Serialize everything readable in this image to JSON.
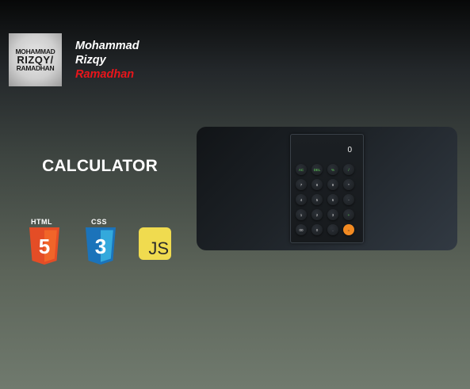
{
  "profile": {
    "logo_line1": "MOHAMMAD",
    "logo_line2": "RIZQY/",
    "logo_line3": "RAMADHAN",
    "name_first": "Mohammad",
    "name_middle": "Rizqy",
    "name_last": "Ramadhan"
  },
  "project": {
    "title": "CALCULATOR"
  },
  "tech_stack": {
    "html_label": "HTML",
    "html_number": "5",
    "css_label": "CSS",
    "css_number": "3",
    "js_label": "JS"
  },
  "calculator_preview": {
    "display_value": "0",
    "keys": [
      {
        "label": "AC",
        "style": "green"
      },
      {
        "label": "DEL",
        "style": "green"
      },
      {
        "label": "%",
        "style": "green"
      },
      {
        "label": "/",
        "style": "green"
      },
      {
        "label": "7",
        "style": "normal"
      },
      {
        "label": "8",
        "style": "normal"
      },
      {
        "label": "9",
        "style": "normal"
      },
      {
        "label": "*",
        "style": "normal"
      },
      {
        "label": "4",
        "style": "normal"
      },
      {
        "label": "5",
        "style": "normal"
      },
      {
        "label": "6",
        "style": "normal"
      },
      {
        "label": "-",
        "style": "normal"
      },
      {
        "label": "1",
        "style": "normal"
      },
      {
        "label": "2",
        "style": "normal"
      },
      {
        "label": "3",
        "style": "normal"
      },
      {
        "label": "+",
        "style": "green"
      },
      {
        "label": "00",
        "style": "normal"
      },
      {
        "label": "0",
        "style": "normal"
      },
      {
        "label": ".",
        "style": "normal"
      },
      {
        "label": "=",
        "style": "orange"
      }
    ]
  },
  "colors": {
    "accent_red": "#e8151b",
    "html_orange": "#e44d26",
    "css_blue": "#1b73ba",
    "js_yellow": "#f0db4f",
    "equals_orange": "#f28a22",
    "operator_green": "#63d35a"
  }
}
